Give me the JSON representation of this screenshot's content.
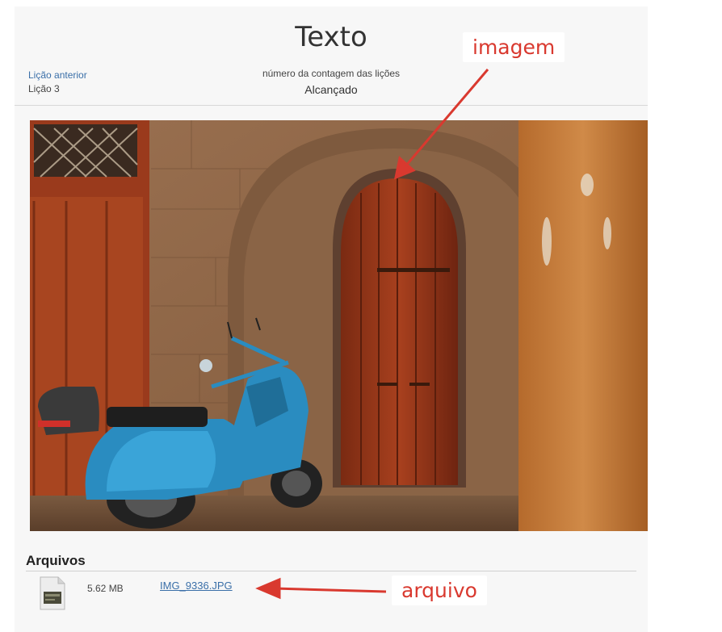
{
  "header": {
    "title": "Texto",
    "previous_link": "Lição anterior",
    "previous_lesson": "Lição 3",
    "count_label": "número da contagem das lições",
    "count_value": "Alcançado"
  },
  "image": {
    "icon": "photo-image"
  },
  "files": {
    "title": "Arquivos",
    "items": [
      {
        "size": "5.62 MB",
        "name": "IMG_9336.JPG",
        "icon": "file-thumbnail-icon"
      }
    ]
  },
  "annotations": {
    "image_callout": "imagem",
    "file_callout": "arquivo",
    "color": "#d9392f"
  }
}
